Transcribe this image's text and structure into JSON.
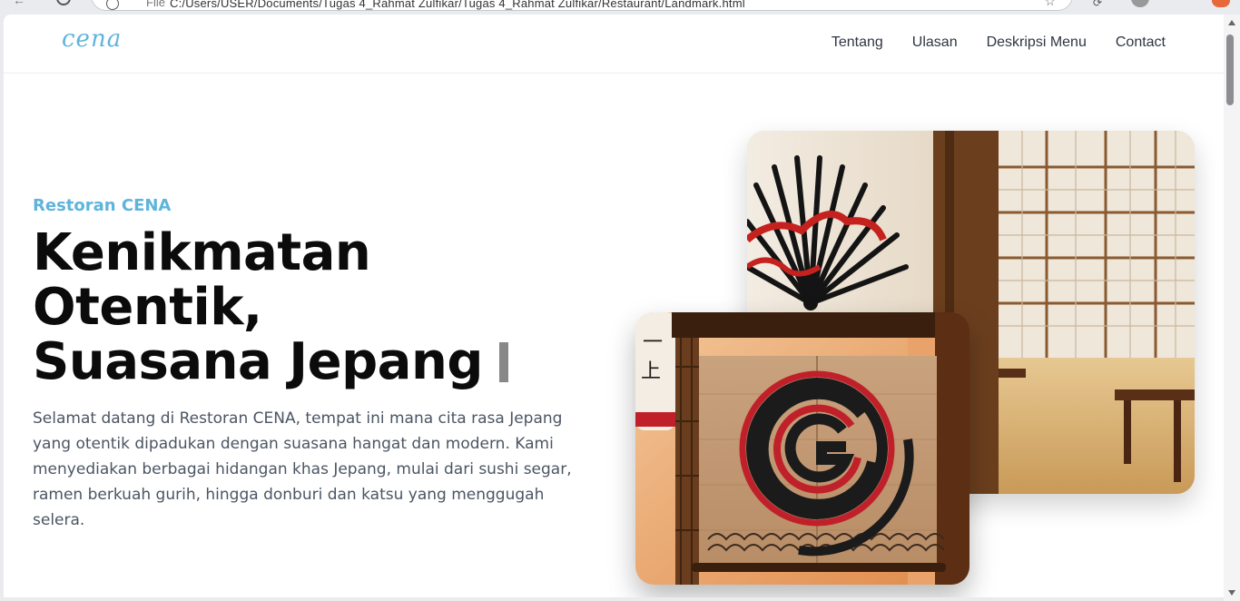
{
  "browser": {
    "url": "C:/Users/USER/Documents/Tugas 4_Rahmat Zulfikar/Tugas 4_Rahmat Zulfikar/Restaurant/Landmark.html",
    "url_prefix": "File"
  },
  "navbar": {
    "logo": "CENA",
    "links": [
      "Tentang",
      "Ulasan",
      "Deskripsi Menu",
      "Contact"
    ]
  },
  "hero": {
    "subtitle": "Restoran CENA",
    "headline_line1": "Kenikmatan Otentik,",
    "headline_line2": "Suasana Jepang",
    "description": "Selamat datang di Restoran CENA, tempat ini mana cita rasa Jepang yang otentik dipadukan dengan suasana hangat dan modern. Kami menyediakan berbagai hidangan khas Jepang, mulai dari sushi segar, ramen berkuah gurih, hingga donburi dan katsu yang menggugah selera."
  },
  "colors": {
    "accent": "#5fb4dc",
    "headline": "#0b0b0b",
    "body_text": "#4b5563",
    "logo_red": "#c0202a"
  }
}
